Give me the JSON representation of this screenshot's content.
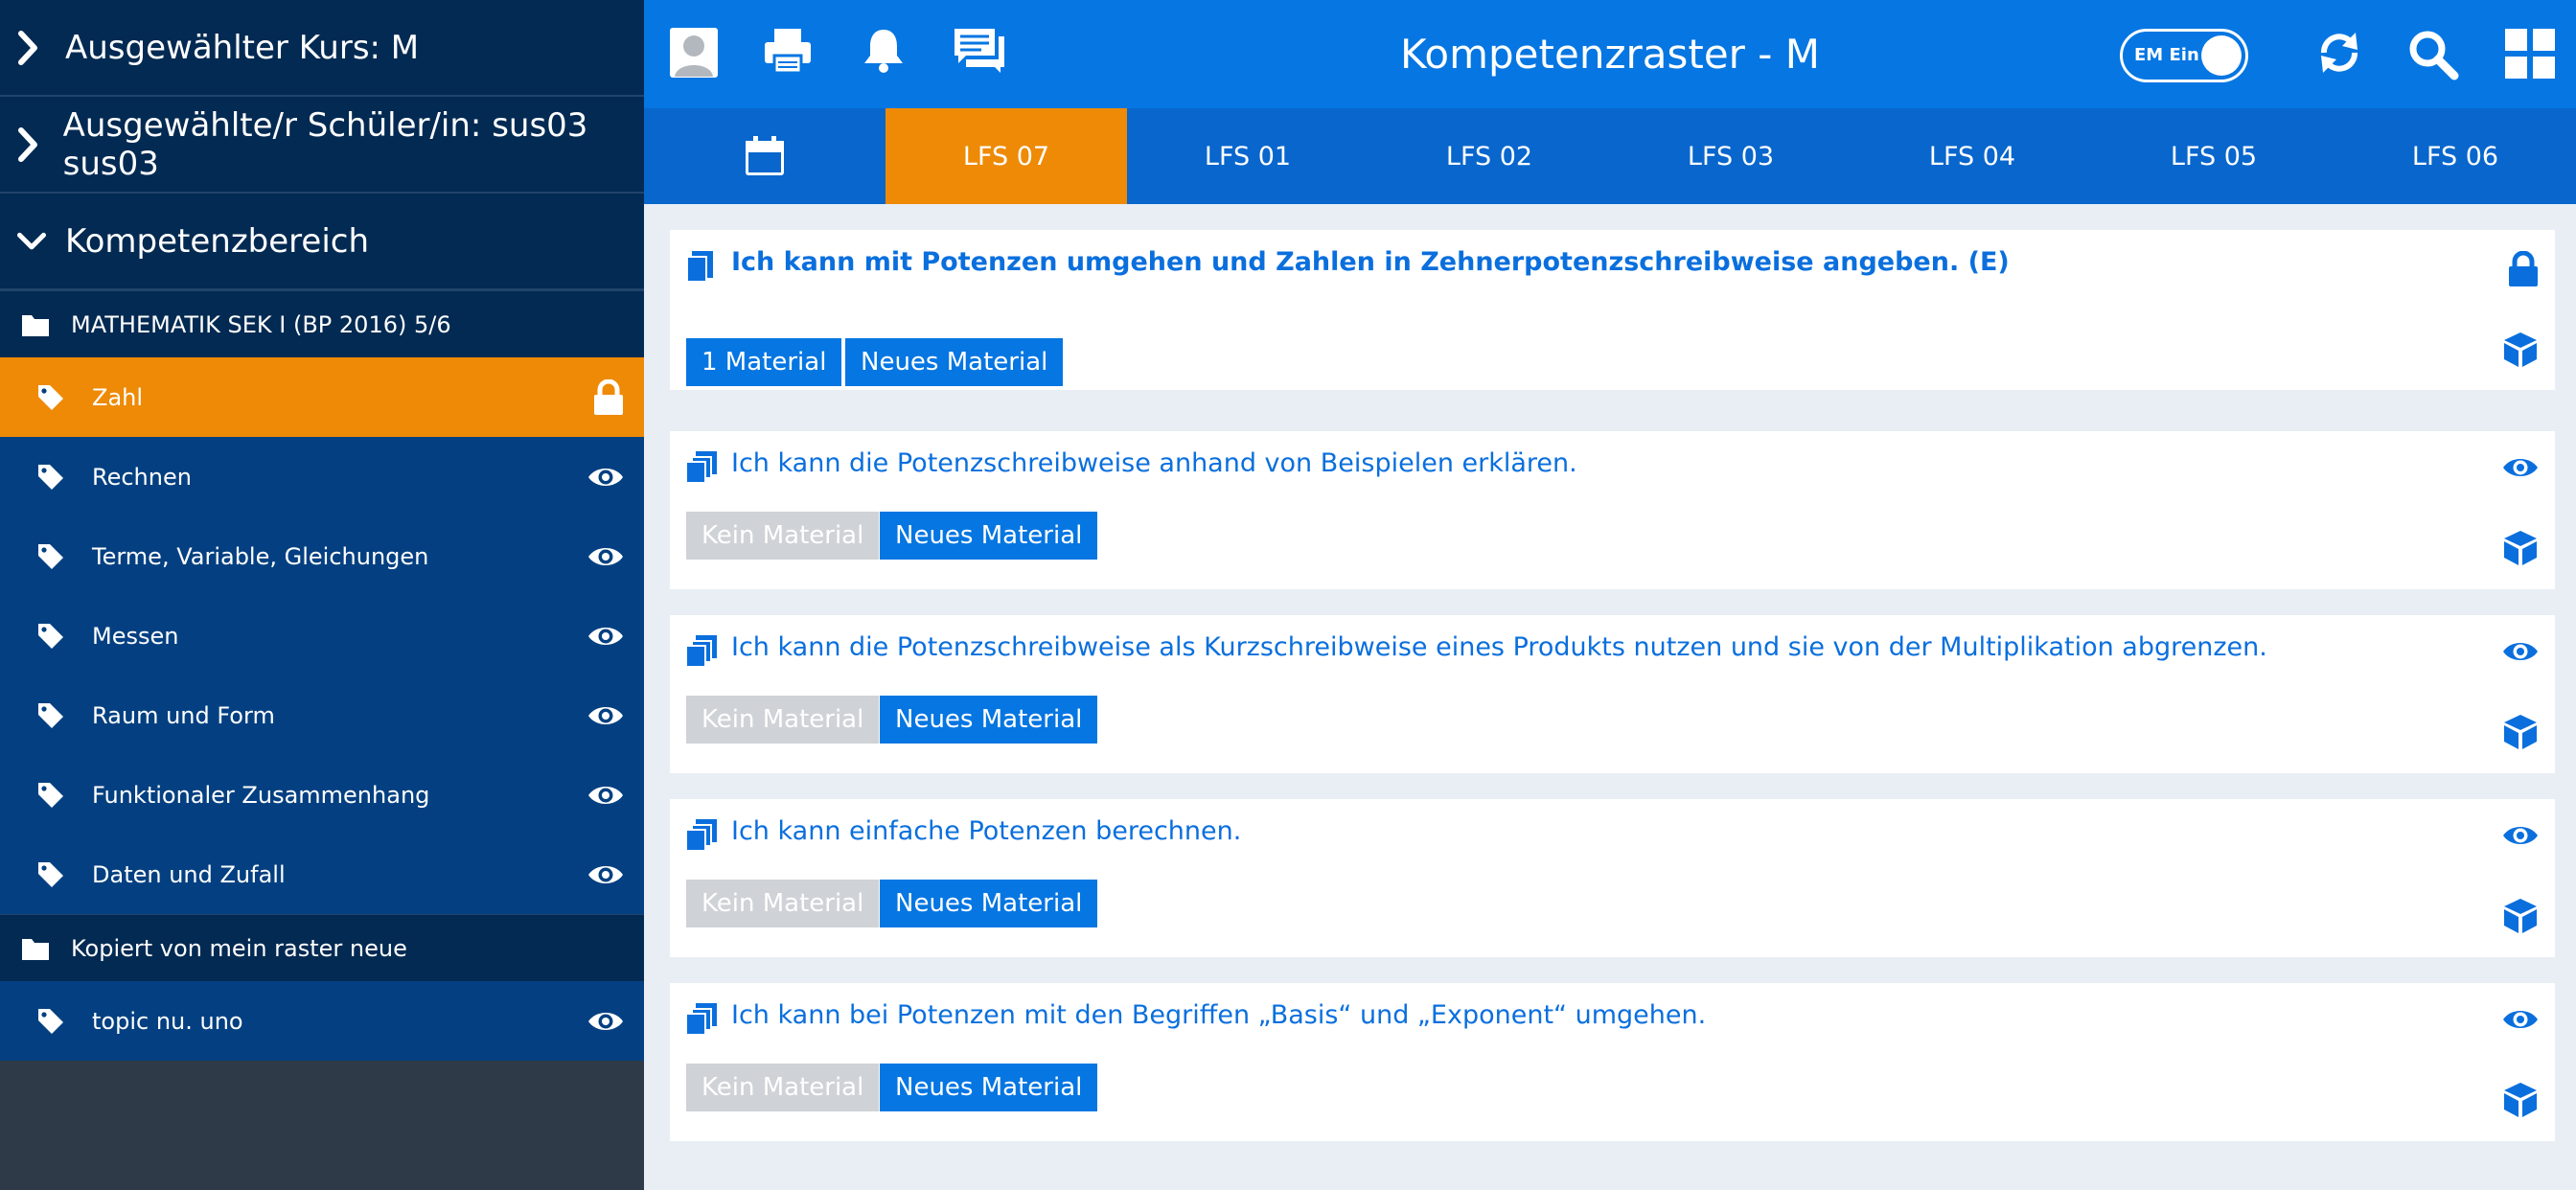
{
  "colors": {
    "sidebar_dark": "#032a52",
    "sidebar_item": "#044081",
    "accent_orange": "#ee8a06",
    "topbar_blue": "#0576e2",
    "tabs_blue": "#0866cd",
    "link_blue": "#0a6fdd",
    "grey_button": "#cfd2d6"
  },
  "sidebar": {
    "course_label": "Ausgewählter Kurs: M",
    "student_label": "Ausgewählte/r Schüler/in: sus03 sus03",
    "area_label": "Kompetenzbereich",
    "groups": [
      {
        "label": "MATHEMATIK SEK I (BP 2016) 5/6",
        "icon": "folder-icon",
        "items": [
          {
            "label": "Zahl",
            "icon": "lock-icon",
            "active": true
          },
          {
            "label": "Rechnen",
            "icon": "eye-icon"
          },
          {
            "label": "Terme, Variable, Gleichungen",
            "icon": "eye-icon"
          },
          {
            "label": "Messen",
            "icon": "eye-icon"
          },
          {
            "label": "Raum und Form",
            "icon": "eye-icon"
          },
          {
            "label": "Funktionaler Zusammenhang",
            "icon": "eye-icon"
          },
          {
            "label": "Daten und Zufall",
            "icon": "eye-icon"
          }
        ]
      },
      {
        "label": "Kopiert von mein raster neue",
        "icon": "folder-icon",
        "items": [
          {
            "label": "topic nu. uno",
            "icon": "eye-icon"
          }
        ]
      }
    ]
  },
  "topbar": {
    "title": "Kompetenzraster - M",
    "toggle_label": "EM Ein",
    "toggle_on": true,
    "icons": [
      "user-icon",
      "printer-icon",
      "bell-icon",
      "chat-icon",
      "refresh-icon",
      "search-icon",
      "grid-icon"
    ]
  },
  "tabs": [
    {
      "label": "calendar-icon",
      "is_icon": true
    },
    {
      "label": "LFS 07",
      "active": true
    },
    {
      "label": "LFS 01"
    },
    {
      "label": "LFS 02"
    },
    {
      "label": "LFS 03"
    },
    {
      "label": "LFS 04"
    },
    {
      "label": "LFS 05"
    },
    {
      "label": "LFS 06"
    }
  ],
  "competencies": [
    {
      "title": "Ich kann mit Potenzen umgehen und Zahlen in Zehnerpotenzschreibweise angeben. (E)",
      "bold": true,
      "material_label": "1 Material",
      "material_available": true,
      "new_label": "Neues Material",
      "status_icon": "lock-icon"
    },
    {
      "title": "Ich kann die Potenzschreibweise anhand von Beispielen erklären.",
      "material_label": "Kein Material",
      "material_available": false,
      "new_label": "Neues Material",
      "status_icon": "eye-icon"
    },
    {
      "title": "Ich kann die Potenzschreibweise als Kurzschreibweise eines Produkts nutzen und sie von der Multiplikation abgrenzen.",
      "material_label": "Kein Material",
      "material_available": false,
      "new_label": "Neues Material",
      "status_icon": "eye-icon"
    },
    {
      "title": "Ich kann einfache Potenzen berechnen.",
      "material_label": "Kein Material",
      "material_available": false,
      "new_label": "Neues Material",
      "status_icon": "eye-icon"
    },
    {
      "title": "Ich kann bei Potenzen mit den Begriffen „Basis“ und „Exponent“ umgehen.",
      "material_label": "Kein Material",
      "material_available": false,
      "new_label": "Neues Material",
      "status_icon": "eye-icon"
    }
  ]
}
